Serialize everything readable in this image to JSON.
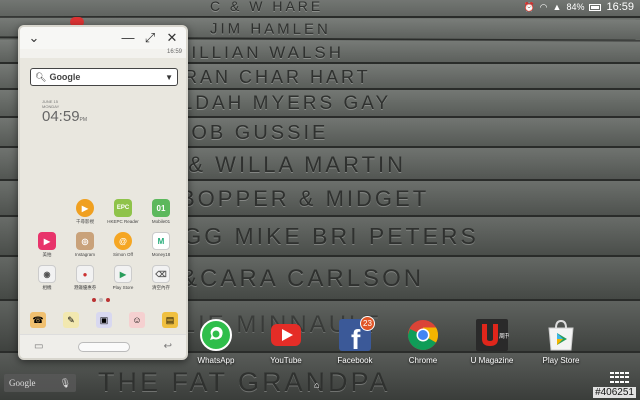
{
  "status_bar": {
    "battery_percent": "84%",
    "time": "16:59"
  },
  "wallpaper": {
    "planks": [
      "C & W HARE",
      "JIM HAMLEN",
      "JILLIAN WALSH",
      "FRAN  CHAR HART",
      "ALDAH MYERS GAY",
      "BOB  GUSSIE",
      "Y & WILLA MARTIN",
      "BOPPER & MIDGET",
      "EGG MIKE BRI PETERS",
      "E&CARA CARLSON",
      "OLIE MINNAULT",
      "THE FAT GRANDPA"
    ]
  },
  "popup_window": {
    "status_time": "16:59",
    "search_label": "Google",
    "clock": {
      "date_line_1": "JUNE 15",
      "date_line_2": "MONDAY",
      "time": "04:59",
      "suffix": "PM"
    },
    "app_rows": [
      [
        {
          "label": "千尋影視",
          "icon": "play-circle-icon",
          "color": "#f0a020",
          "glyph": "▶"
        },
        {
          "label": "HKEPC Reader",
          "icon": "epc-icon",
          "color": "#8fc34a",
          "glyph": "EPC"
        },
        {
          "label": "Mobile01",
          "icon": "mobile01-icon",
          "color": "#5cb85c",
          "glyph": "01"
        }
      ],
      [
        {
          "label": "美拍",
          "icon": "video-camera-icon",
          "color": "#e8346b",
          "glyph": "▶"
        },
        {
          "label": "Instagram",
          "icon": "instagram-icon",
          "color": "#c9a27a",
          "glyph": "◎"
        },
        {
          "label": "Simon Off",
          "icon": "simon-icon",
          "color": "#f5a623",
          "glyph": "@"
        },
        {
          "label": "Money18",
          "icon": "money18-icon",
          "color": "#ffffff",
          "glyph": "M"
        }
      ],
      [
        {
          "label": "相機",
          "icon": "camera-icon",
          "color": "#f2f2f2",
          "glyph": "◉"
        },
        {
          "label": "港鐵優惠券",
          "icon": "traffic-light-icon",
          "color": "#f2f2f2",
          "glyph": "●"
        },
        {
          "label": "Play Store",
          "icon": "play-store-icon",
          "color": "#f2f2f2",
          "glyph": "▶"
        },
        {
          "label": "清空內存",
          "icon": "memory-clean-icon",
          "color": "#f2f2f2",
          "glyph": "⌫"
        }
      ]
    ],
    "dock": [
      {
        "icon": "phone-icon",
        "glyph": "☎",
        "color": "#f0c070"
      },
      {
        "icon": "notes-icon",
        "glyph": "✎",
        "color": "#f2e8b0"
      },
      {
        "icon": "bus-icon",
        "glyph": "▣",
        "color": "#d8d8f0"
      },
      {
        "icon": "cat-icon",
        "glyph": "☺",
        "color": "#f5d0d0"
      },
      {
        "icon": "sim-card-icon",
        "glyph": "▤",
        "color": "#f0c040"
      }
    ]
  },
  "dock_apps": [
    {
      "label": "WhatsApp",
      "icon": "whatsapp-icon"
    },
    {
      "label": "YouTube",
      "icon": "youtube-icon"
    },
    {
      "label": "Facebook",
      "icon": "facebook-icon",
      "badge": "23"
    },
    {
      "label": "Chrome",
      "icon": "chrome-icon"
    },
    {
      "label": "U Magazine",
      "icon": "u-magazine-icon"
    },
    {
      "label": "Play Store",
      "icon": "play-store-icon"
    }
  ],
  "google_widget": {
    "label": "Google"
  },
  "watermark": "#406251"
}
